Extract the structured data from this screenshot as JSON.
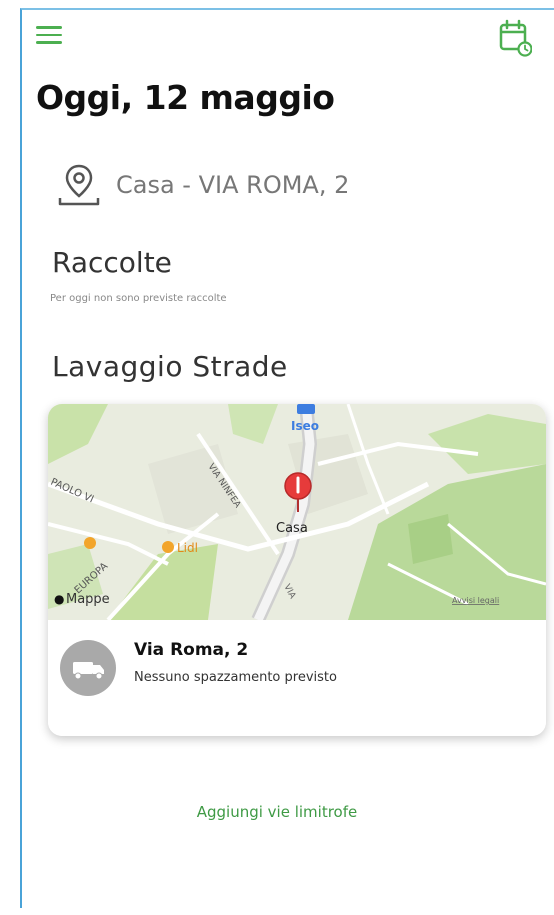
{
  "header": {
    "menu_icon": "hamburger-menu-icon",
    "calendar_icon": "calendar-clock-icon",
    "accent_color": "#4caf50"
  },
  "date_title": "Oggi, 12 maggio",
  "address": {
    "icon": "location-pin-icon",
    "label": "Casa - VIA ROMA, 2"
  },
  "raccolte": {
    "title": "Raccolte",
    "subtitle": "Per oggi non sono previste raccolte"
  },
  "lavaggio": {
    "title": "Lavaggio Strade",
    "map": {
      "place_label": "Casa",
      "town_label": "Iseo",
      "street_labels": [
        "PAOLO VI",
        "VIA NINFEA",
        "EUROPA",
        "VIA"
      ],
      "poi_label": "Lidl",
      "attribution": "Mappe",
      "legal": "Avvisi legali"
    },
    "street": {
      "name": "Via Roma, 2",
      "status": "Nessuno spazzamento previsto",
      "icon": "street-sweeper-truck-icon"
    }
  },
  "add_nearby_link": "Aggiungi vie limitrofe"
}
